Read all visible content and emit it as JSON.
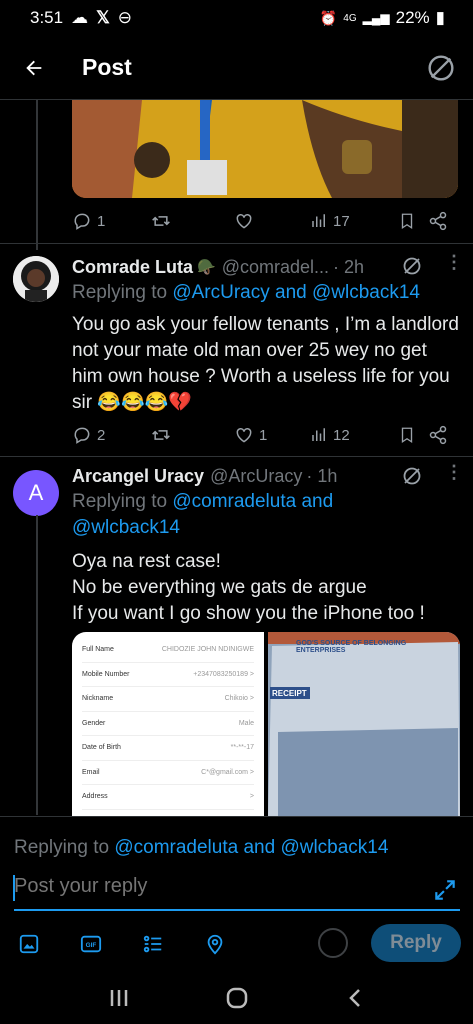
{
  "status_bar": {
    "time": "3:51",
    "network": "4G",
    "battery": "22%"
  },
  "header": {
    "title": "Post"
  },
  "top_tweet_actions": {
    "replies": "1",
    "views": "17"
  },
  "tweet1": {
    "name": "Comrade Luta",
    "handle": "@comradel...",
    "time": "· 2h",
    "replying_prefix": "Replying to",
    "replying_to": "@ArcUracy and @wlcback14",
    "text": "You go ask your fellow tenants , I’m a landlord not your mate old man over 25 wey no get him own house ? Worth a useless life for you sir 😂😂😂💔",
    "replies": "2",
    "likes": "1",
    "views": "12"
  },
  "tweet2": {
    "avatar_letter": "A",
    "name": "Arcangel Uracy",
    "handle": "@ArcUracy",
    "time": "· 1h",
    "replying_prefix": "Replying to",
    "replying_to": "@comradeluta and @wlcback14",
    "text": "Oya na rest case!\nNo be everything we gats de argue\nIf you want I go show you the iPhone too !",
    "profile_card": [
      {
        "label": "Full Name",
        "value": "CHIDOZIE JOHN NDINIGWE"
      },
      {
        "label": "Mobile Number",
        "value": "+2347083250189 >"
      },
      {
        "label": "Nickname",
        "value": "Chikoio >"
      },
      {
        "label": "Gender",
        "value": "Male"
      },
      {
        "label": "Date of Birth",
        "value": "**-**-17"
      },
      {
        "label": "Email",
        "value": "C*@gmail.com >"
      },
      {
        "label": "Address",
        "value": ">"
      }
    ],
    "receipt_header": "GOD'S SOURCE OF BELONGING ENTERPRISES",
    "receipt_label": "RECEIPT"
  },
  "reply_bar": {
    "replying_prefix": "Replying to",
    "replying_to": "@comradeluta and @wlcback14",
    "placeholder": "Post your reply",
    "reply_button": "Reply"
  },
  "colors": {
    "accent": "#1d9bf0",
    "avatar_purple": "#7856ff"
  }
}
